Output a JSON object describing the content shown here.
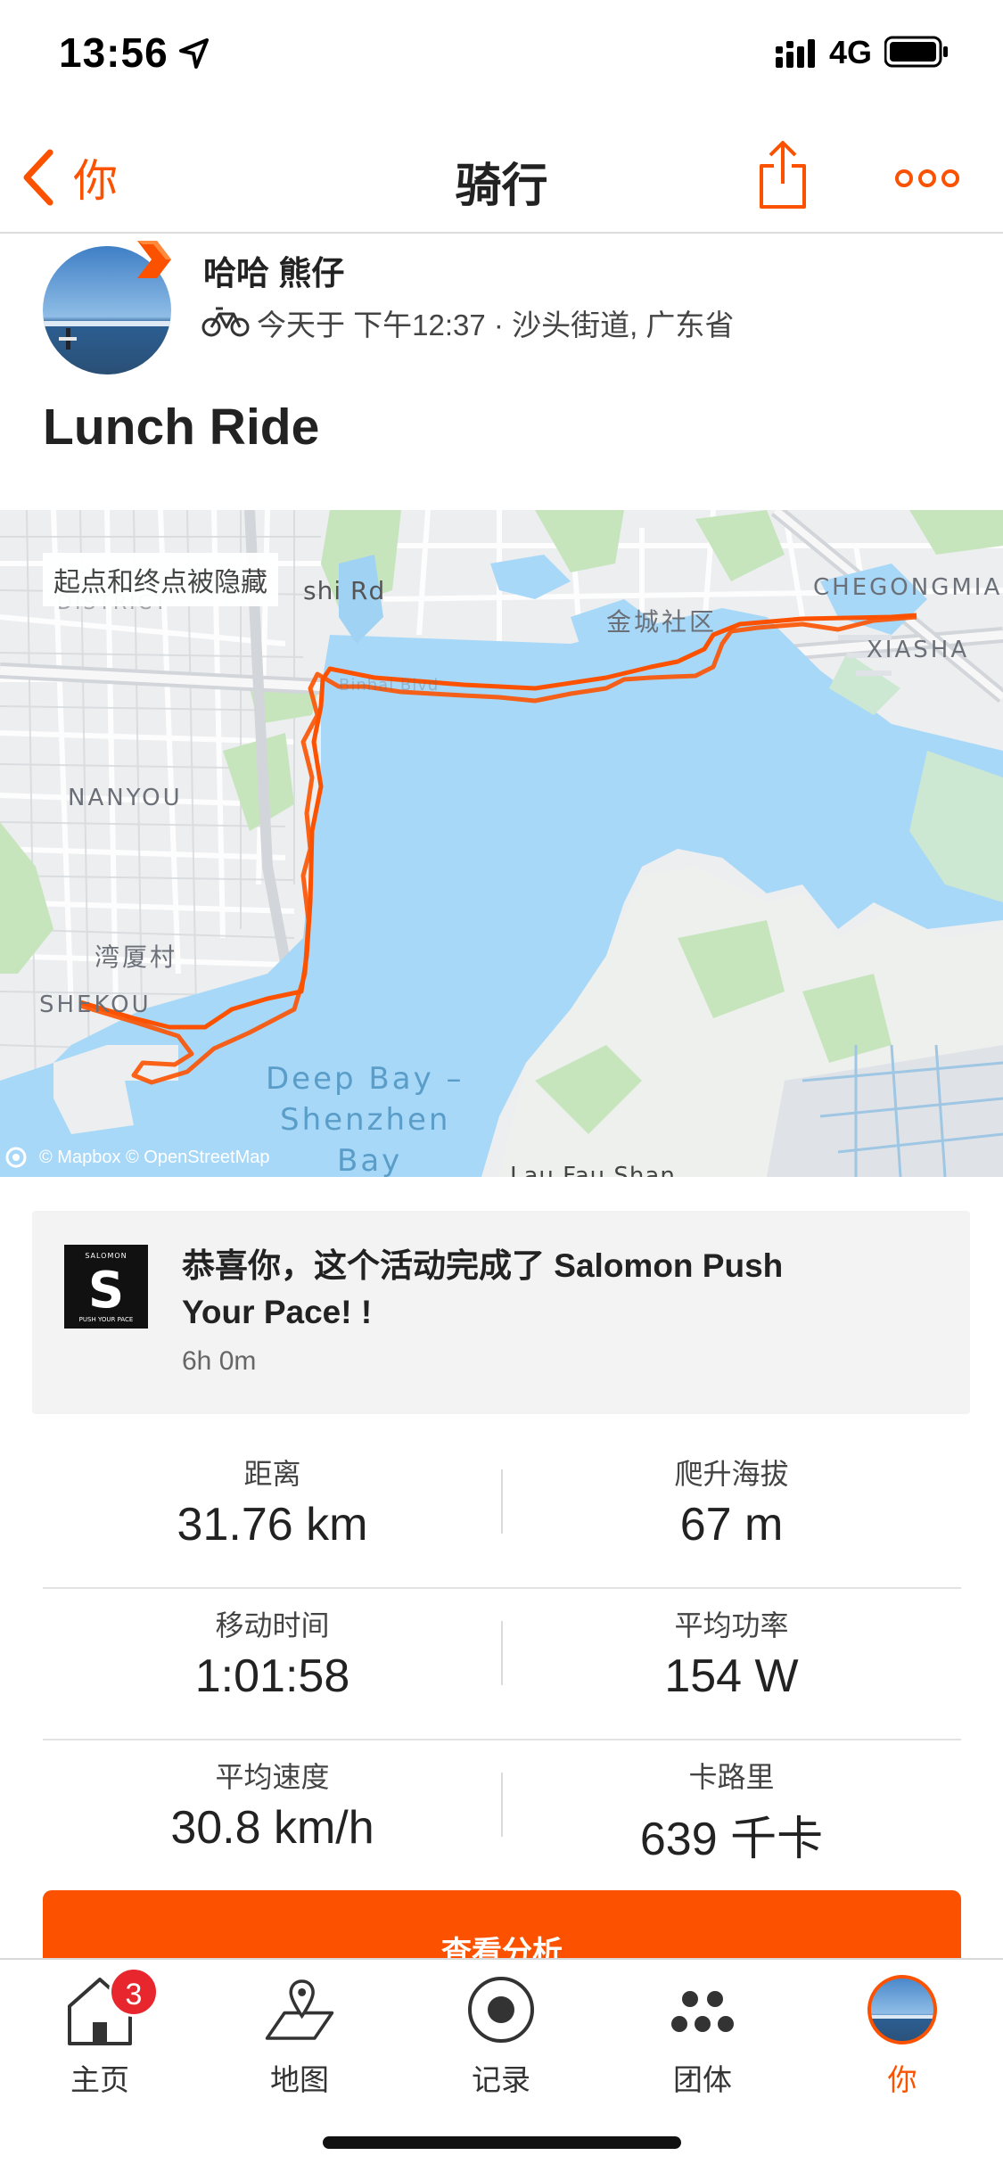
{
  "status_bar": {
    "time": "13:56",
    "network": "4G"
  },
  "nav": {
    "back_label": "你",
    "title": "骑行"
  },
  "athlete": {
    "name": "哈哈 熊仔",
    "meta": "今天于 下午12:37 · 沙头街道, 广东省"
  },
  "activity": {
    "title": "Lunch Ride"
  },
  "map": {
    "hidden_note": "起点和终点被隐藏",
    "attribution": "© Mapbox © OpenStreetMap",
    "labels": {
      "road": "shi Rd",
      "district_cut": "DISTRICT",
      "community": "金城社区",
      "chegongmiao": "CHEGONGMIA",
      "xiasha": "XIASHA",
      "nanyou": "NANYOU",
      "wanxia": "湾厦村",
      "shekou": "SHEKOU",
      "bay_line1": "Deep Bay –",
      "bay_line2": "Shenzhen",
      "bay_line3": "Bay",
      "lau_fau_shan": "Lau Fau Shan",
      "binhai": "Binhai Blvd"
    },
    "colors": {
      "water": "#a8d8f8",
      "route": "#fc5200",
      "park": "#bfe0b4"
    }
  },
  "challenge": {
    "logo_top": "SALOMON",
    "logo_letter": "S",
    "logo_bottom": "PUSH YOUR PACE",
    "text": "恭喜你，这个活动完成了 Salomon Push Your Pace! !",
    "duration": "6h 0m"
  },
  "stats": [
    {
      "label": "距离",
      "value": "31.76 km"
    },
    {
      "label": "爬升海拔",
      "value": "67 m"
    },
    {
      "label": "移动时间",
      "value": "1:01:58"
    },
    {
      "label": "平均功率",
      "value": "154 W"
    },
    {
      "label": "平均速度",
      "value": "30.8 km/h"
    },
    {
      "label": "卡路里",
      "value": "639 千卡"
    }
  ],
  "analysis_button": "查看分析",
  "tabs": [
    {
      "label": "主页",
      "icon": "home-icon",
      "badge": "3"
    },
    {
      "label": "地图",
      "icon": "map-icon"
    },
    {
      "label": "记录",
      "icon": "record-icon"
    },
    {
      "label": "团体",
      "icon": "groups-icon"
    },
    {
      "label": "你",
      "icon": "profile-avatar-icon",
      "active": true
    }
  ],
  "accent_color": "#fc5200"
}
